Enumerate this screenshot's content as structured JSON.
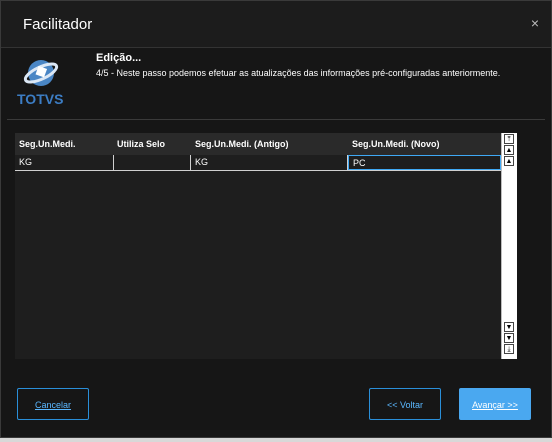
{
  "dialog": {
    "title": "Facilitador",
    "close_label": "×"
  },
  "logo": {
    "text": "TOTVS"
  },
  "step": {
    "title": "Edição...",
    "description": "4/5 - Neste passo podemos efetuar as atualizações das informações pré-configuradas anteriormente."
  },
  "grid": {
    "columns": [
      "Seg.Un.Medi.",
      "Utiliza Selo",
      "Seg.Un.Medi. (Antigo)",
      "Seg.Un.Medi. (Novo)"
    ],
    "rows": [
      [
        "KG",
        "",
        "KG",
        "PC"
      ]
    ],
    "scroll_buttons": {
      "top": "⤒",
      "up": "▲",
      "down": "▼",
      "bottom": "⤓"
    }
  },
  "buttons": {
    "cancel": "Cancelar",
    "back": "<< Voltar",
    "next": "Avançar >>"
  },
  "colors": {
    "accent": "#4aa8f0",
    "background": "#161616"
  }
}
